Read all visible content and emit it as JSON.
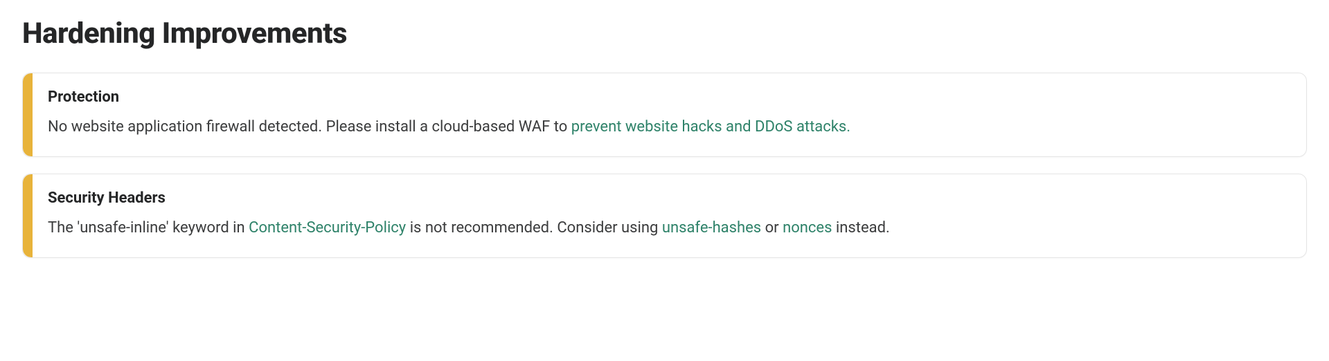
{
  "title": "Hardening Improvements",
  "accent_color": "#e8b33a",
  "link_color": "#2e8269",
  "alerts": [
    {
      "heading": "Protection",
      "text_before": "No website application firewall detected. Please install a cloud-based WAF to ",
      "links": [
        {
          "label": "prevent website hacks and DDoS attacks."
        }
      ],
      "segments_after": []
    },
    {
      "heading": "Security Headers",
      "text_before": "The 'unsafe-inline' keyword in ",
      "links": [
        {
          "label": "Content-Security-Policy"
        },
        {
          "label": "unsafe-hashes"
        },
        {
          "label": "nonces"
        }
      ],
      "segments_after": [
        " is not recommended. Consider using ",
        " or ",
        " instead."
      ]
    }
  ]
}
